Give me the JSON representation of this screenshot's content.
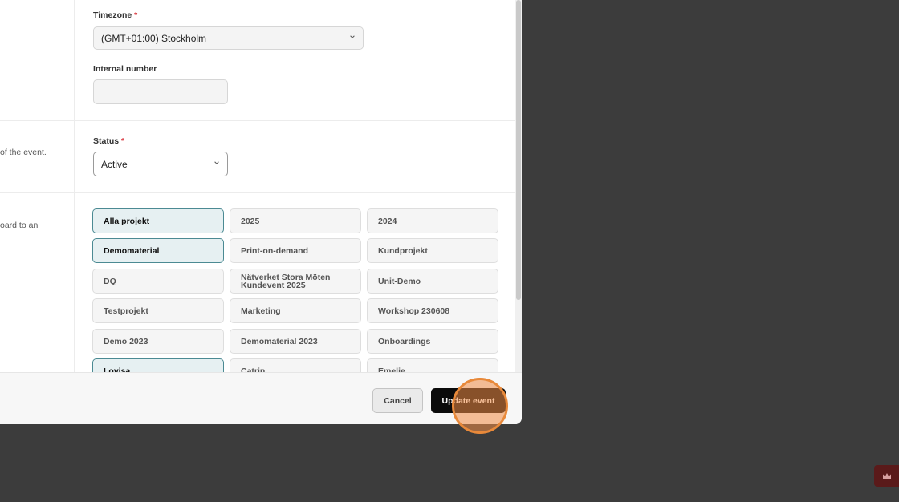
{
  "timezone": {
    "label": "Timezone",
    "required_mark": "*",
    "value": "(GMT+01:00) Stockholm"
  },
  "internal_number": {
    "label": "Internal number",
    "value": ""
  },
  "status": {
    "description_fragment": "of the event.",
    "label": "Status",
    "required_mark": "*",
    "value": "Active"
  },
  "projects": {
    "description_fragment": "oard to an",
    "items": [
      {
        "label": "Alla projekt",
        "selected": true
      },
      {
        "label": "2025",
        "selected": false
      },
      {
        "label": "2024",
        "selected": false
      },
      {
        "label": "Demomaterial",
        "selected": true
      },
      {
        "label": "Print-on-demand",
        "selected": false
      },
      {
        "label": "Kundprojekt",
        "selected": false
      },
      {
        "label": "DQ",
        "selected": false
      },
      {
        "label": "Nätverket Stora Möten Kundevent 2025",
        "selected": false
      },
      {
        "label": "Unit-Demo",
        "selected": false
      },
      {
        "label": "Testprojekt",
        "selected": false
      },
      {
        "label": "Marketing",
        "selected": false
      },
      {
        "label": "Workshop 230608",
        "selected": false
      },
      {
        "label": "Demo 2023",
        "selected": false
      },
      {
        "label": "Demomaterial 2023",
        "selected": false
      },
      {
        "label": "Onboardings",
        "selected": false
      },
      {
        "label": "Lovisa",
        "selected": true
      },
      {
        "label": "Catrin",
        "selected": false
      },
      {
        "label": "Emelie",
        "selected": false
      }
    ]
  },
  "footer": {
    "cancel_label": "Cancel",
    "update_label": "Update event"
  },
  "icons": {
    "select_chevron": "chevron-down-icon",
    "widget": "crown-icon"
  },
  "colors": {
    "primary_button": "#0b0b0b",
    "selected_tag_border": "#4b8a93",
    "selected_tag_bg": "#e6f0f2",
    "required": "#d9363e",
    "click_highlight": "#e8893a",
    "widget_bg": "#5a1a1a"
  }
}
